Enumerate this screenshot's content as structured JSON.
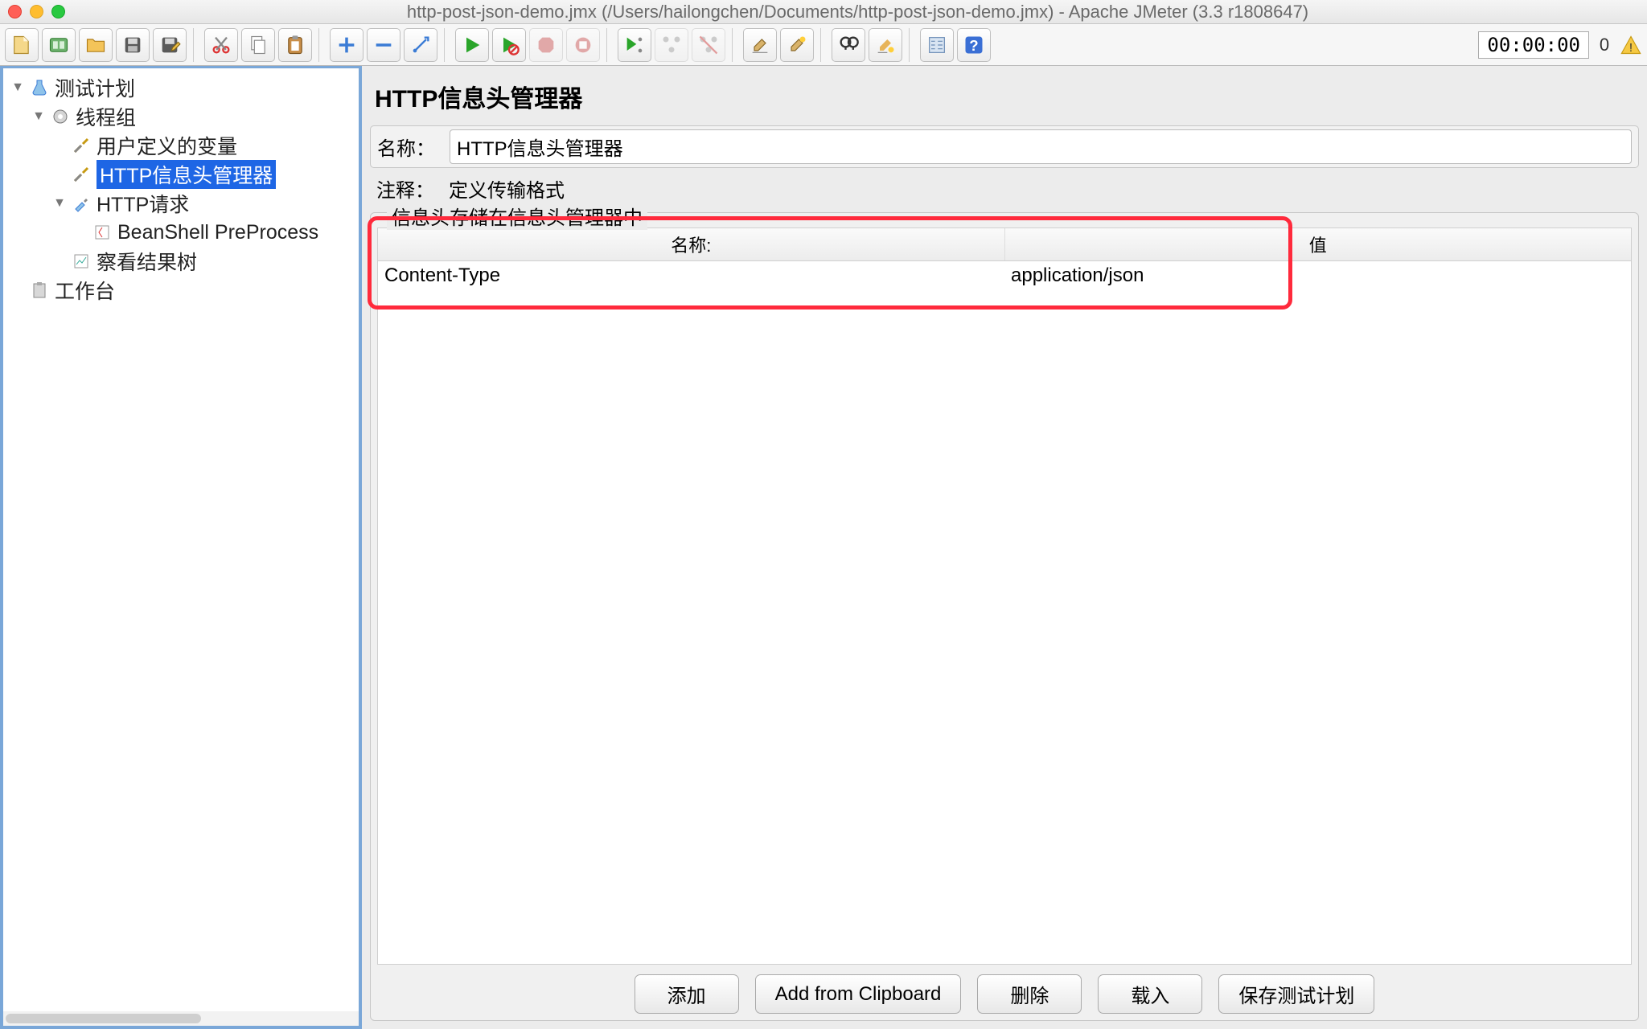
{
  "window": {
    "title": "http-post-json-demo.jmx (/Users/hailongchen/Documents/http-post-json-demo.jmx) - Apache JMeter (3.3 r1808647)"
  },
  "toolbar": {
    "timer": "00:00:00",
    "counter": "0"
  },
  "tree": {
    "root": "测试计划",
    "thread_group": "线程组",
    "user_vars": "用户定义的变量",
    "header_mgr": "HTTP信息头管理器",
    "http_req": "HTTP请求",
    "beanshell": "BeanShell PreProcess",
    "view_tree": "察看结果树",
    "workbench": "工作台"
  },
  "panel": {
    "title": "HTTP信息头管理器",
    "name_label": "名称：",
    "name_value": "HTTP信息头管理器",
    "comment_label": "注释：",
    "comment_value": "定义传输格式",
    "group_title": "信息头存储在信息头管理器中",
    "table": {
      "col_name": "名称:",
      "col_value": "值",
      "rows": [
        {
          "name": "Content-Type",
          "value": "application/json"
        }
      ]
    },
    "buttons": {
      "add": "添加",
      "add_clipboard": "Add from Clipboard",
      "delete": "删除",
      "load": "载入",
      "save": "保存测试计划"
    }
  }
}
